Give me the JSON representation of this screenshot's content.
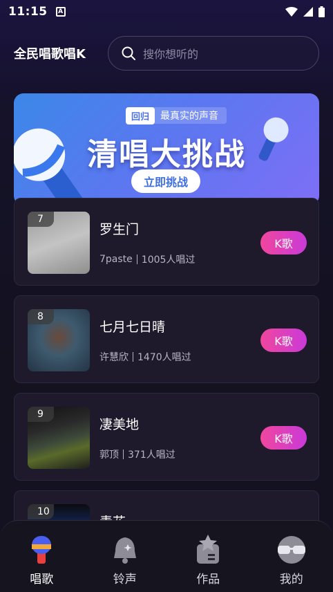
{
  "status_bar": {
    "time": "11:15",
    "app_badge": "A"
  },
  "header": {
    "title": "全民唱歌唱K",
    "search_placeholder": "搜你想听的"
  },
  "banner": {
    "tag": "回归",
    "tagline": "最真实的声音",
    "title": "清唱大挑战",
    "button": "立即挑战"
  },
  "songs": [
    {
      "rank": "7",
      "title": "罗生门",
      "artist": "7paste",
      "sung": "1005人唱过",
      "action": "K歌"
    },
    {
      "rank": "8",
      "title": "七月七日晴",
      "artist": "许慧欣",
      "sung": "1470人唱过",
      "action": "K歌"
    },
    {
      "rank": "9",
      "title": "凄美地",
      "artist": "郭顶",
      "sung": "371人唱过",
      "action": "K歌"
    },
    {
      "rank": "10",
      "title": "青花",
      "artist": "",
      "sung": "",
      "action": ""
    }
  ],
  "tabs": [
    {
      "label": "唱歌",
      "icon": "microphone-icon",
      "active": true
    },
    {
      "label": "铃声",
      "icon": "bell-icon",
      "active": false
    },
    {
      "label": "作品",
      "icon": "works-icon",
      "active": false
    },
    {
      "label": "我的",
      "icon": "profile-glasses-icon",
      "active": false
    }
  ],
  "colors": {
    "accent_pink": "#f0469e",
    "accent_purple": "#c93ad8",
    "banner_blue": "#3c88e8"
  }
}
